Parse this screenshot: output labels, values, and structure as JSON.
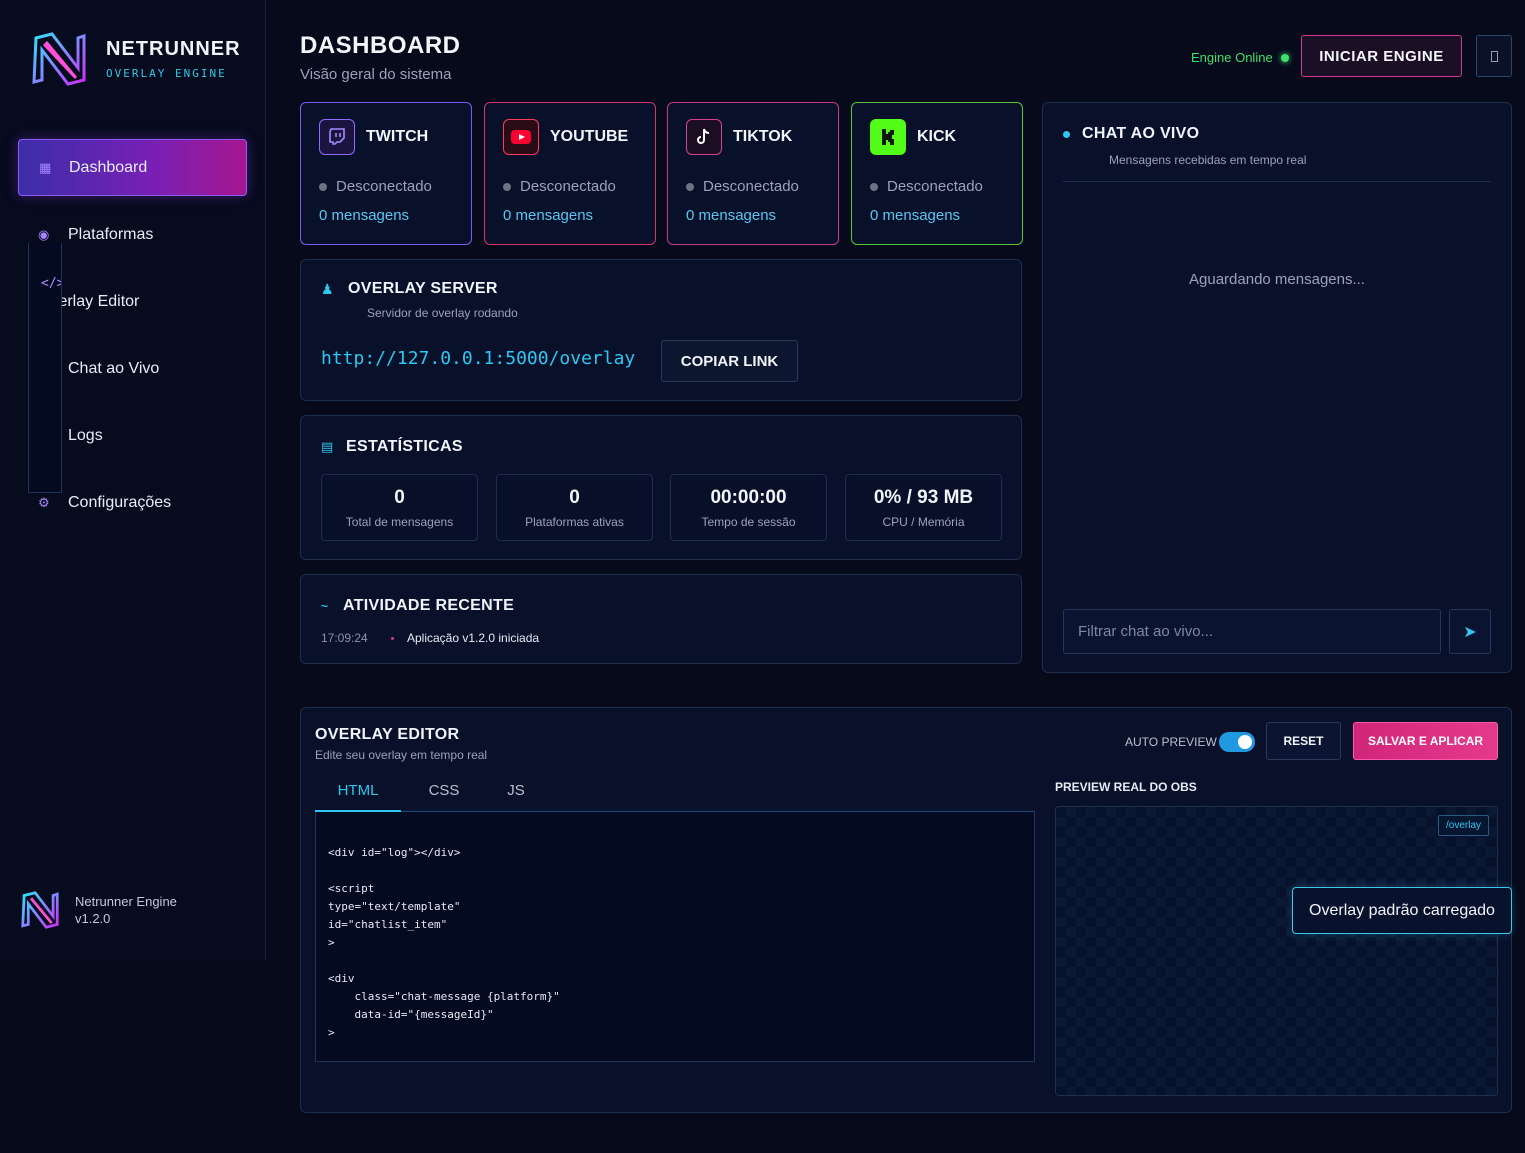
{
  "brand": {
    "name": "NETRUNNER",
    "sub": "OVERLAY ENGINE"
  },
  "nav": [
    {
      "label": "Dashboard",
      "icon": "grid-icon"
    },
    {
      "label": "Plataformas",
      "icon": "circle-dot-icon"
    },
    {
      "label": "Overlay Editor",
      "icon": "code-icon",
      "glyph": "</>"
    },
    {
      "label": "Chat ao Vivo",
      "icon": "chat-square-icon"
    },
    {
      "label": "Logs",
      "icon": "list-icon"
    },
    {
      "label": "Configurações",
      "icon": "gear-icon"
    }
  ],
  "footer": {
    "name": "Netrunner Engine",
    "version": "v1.2.0"
  },
  "header": {
    "title": "DASHBOARD",
    "subtitle": "Visão geral do sistema",
    "engine_status": "Engine Online",
    "start_button": "INICIAR ENGINE"
  },
  "platforms": [
    {
      "name": "TWITCH",
      "status": "Desconectado",
      "messages": "0 mensagens",
      "color": "#9146ff"
    },
    {
      "name": "YOUTUBE",
      "status": "Desconectado",
      "messages": "0 mensagens",
      "color": "#ff0033"
    },
    {
      "name": "TIKTOK",
      "status": "Desconectado",
      "messages": "0 mensagens",
      "color": "#ee1d52"
    },
    {
      "name": "KICK",
      "status": "Desconectado",
      "messages": "0 mensagens",
      "color": "#53fc18"
    }
  ],
  "overlay_server": {
    "title": "OVERLAY SERVER",
    "subtitle": "Servidor de overlay rodando",
    "url": "http://127.0.0.1:5000/overlay",
    "copy_button": "COPIAR LINK"
  },
  "stats": {
    "title": "ESTATÍSTICAS",
    "items": [
      {
        "value": "0",
        "label": "Total de mensagens"
      },
      {
        "value": "0",
        "label": "Plataformas ativas"
      },
      {
        "value": "00:00:00",
        "label": "Tempo de sessão"
      },
      {
        "value": "0% / 93 MB",
        "label": "CPU / Memória"
      }
    ]
  },
  "activity": {
    "title": "ATIVIDADE RECENTE",
    "items": [
      {
        "time": "17:09:24",
        "text": "Aplicação v1.2.0 iniciada"
      }
    ]
  },
  "chat": {
    "title": "CHAT AO VIVO",
    "subtitle": "Mensagens recebidas em tempo real",
    "empty": "Aguardando mensagens...",
    "filter_placeholder": "Filtrar chat ao vivo..."
  },
  "editor": {
    "title": "OVERLAY EDITOR",
    "subtitle": "Edite seu overlay em tempo real",
    "auto_preview_label": "AUTO PREVIEW",
    "auto_preview_on": true,
    "reset_button": "RESET",
    "save_button": "SALVAR E APLICAR",
    "tabs": [
      "HTML",
      "CSS",
      "JS"
    ],
    "active_tab": "HTML",
    "code": "<div id=\"log\"></div>\n\n<script\ntype=\"text/template\"\nid=\"chatlist_item\"\n>\n\n<div\n    class=\"chat-message {platform}\"\n    data-id=\"{messageId}\"\n>",
    "preview_title": "PREVIEW REAL DO OBS",
    "preview_tag": "/overlay"
  },
  "toast": "Overlay padrão carregado"
}
